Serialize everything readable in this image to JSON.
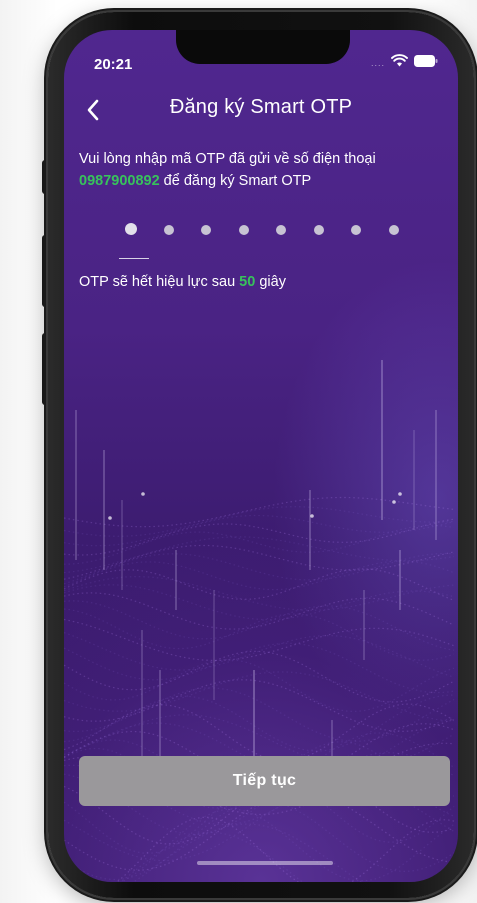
{
  "status_bar": {
    "time": "20:21",
    "signal_dots": "....",
    "wifi_icon": "wifi-icon",
    "battery_icon": "battery-icon"
  },
  "header": {
    "back_icon": "chevron-left-icon",
    "title": "Đăng ký Smart OTP"
  },
  "instruction": {
    "text_before": "Vui lòng nhập mã OTP đã gửi về số điện thoại",
    "phone_number": "0987900892",
    "text_after": " để đăng ký Smart OTP"
  },
  "otp_input": {
    "length": 8,
    "entered": 0
  },
  "expiry": {
    "text_before": "OTP sẽ hết hiệu lực sau ",
    "seconds": "50",
    "text_after": " giây"
  },
  "footer": {
    "continue_label": "Tiếp tục"
  },
  "colors": {
    "accent_green": "#38c25c",
    "background_purple": "#4a2384",
    "button_disabled": "#9a989b"
  }
}
